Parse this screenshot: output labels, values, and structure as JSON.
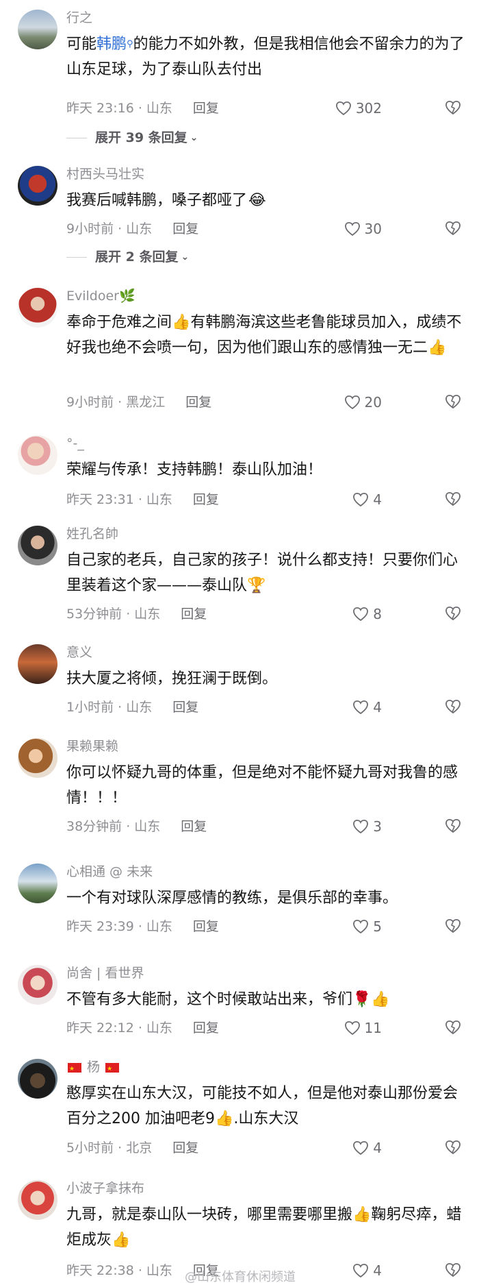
{
  "comments": [
    {
      "username": "行之",
      "content_pre": "可能",
      "highlight": "韩鹏",
      "content_post": "的能力不如外教，但是我相信他会不留余力的为了山东足球，为了泰山队去付出",
      "time_location": "昨天 23:16 · 山东",
      "reply": "回复",
      "likes": "302",
      "expand": "展开 39 条回复"
    },
    {
      "username": "村西头马壮实",
      "content": "我赛后喊韩鹏，嗓子都哑了",
      "emoji": "😂",
      "time_location": "9小时前 · 山东",
      "reply": "回复",
      "likes": "30",
      "expand": "展开 2 条回复"
    },
    {
      "username": "Evildoer",
      "username_emoji": "🌿",
      "content": "奉命于危难之间👍有韩鹏海滨这些老鲁能球员加入，成绩不好我也绝不会喷一句，因为他们跟山东的感情独一无二👍",
      "time_location": "9小时前 · 黑龙江",
      "reply": "回复",
      "likes": "20"
    },
    {
      "username": "°-_",
      "content": "荣耀与传承！支持韩鹏！泰山队加油！",
      "time_location": "昨天 23:31 · 山东",
      "reply": "回复",
      "likes": "4"
    },
    {
      "username": "姓孔名帥",
      "content": "自己家的老兵，自己家的孩子！说什么都支持！只要你们心里装着这个家———泰山队🏆",
      "time_location": "53分钟前 · 山东",
      "reply": "回复",
      "likes": "8"
    },
    {
      "username": "意义",
      "content": "扶大厦之将倾，挽狂澜于既倒。",
      "time_location": "1小时前 · 山东",
      "reply": "回复",
      "likes": "4"
    },
    {
      "username": "果赖果赖",
      "content": "你可以怀疑九哥的体重，但是绝对不能怀疑九哥对我鲁的感情！！！",
      "time_location": "38分钟前 · 山东",
      "reply": "回复",
      "likes": "3"
    },
    {
      "username": "心相通 @ 未来",
      "content": "一个有对球队深厚感情的教练，是俱乐部的幸事。",
      "time_location": "昨天 23:39 · 山东",
      "reply": "回复",
      "likes": "5"
    },
    {
      "username": "尚舍 | 看世界",
      "content": "不管有多大能耐，这个时候敢站出来，爷们🌹👍",
      "time_location": "昨天 22:12 · 山东",
      "reply": "回复",
      "likes": "11"
    },
    {
      "username": "杨",
      "content": "憨厚实在山东大汉，可能技不如人，但是他对泰山那份爱会百分之200 加油吧老9👍.山东大汉",
      "time_location": "5小时前 · 北京",
      "reply": "回复",
      "likes": "4"
    },
    {
      "username": "小波子拿抹布",
      "content": "九哥，就是泰山队一块砖，哪里需要哪里搬👍鞠躬尽瘁，蜡炬成灰👍",
      "time_location": "昨天 22:38 · 山东",
      "reply": "回复",
      "likes": "4"
    }
  ],
  "watermark": "@山东体育休闲频道",
  "colors": {
    "highlight": "#2f6fd6",
    "meta": "#8e8e93"
  }
}
